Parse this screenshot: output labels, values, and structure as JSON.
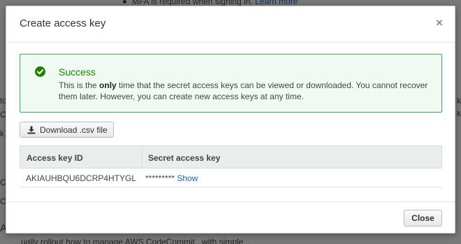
{
  "background": {
    "top_text": "MFA is required when signing in.",
    "top_link": "Learn more",
    "left_fragments": [
      "to",
      "C",
      "k",
      "C",
      "C"
    ],
    "right_fragments": [
      "k",
      "k"
    ],
    "heading_fragment": "A",
    "bottom_text": "...ually rollout how to manage AWS CodeCommit...with simple..."
  },
  "modal": {
    "title": "Create access key",
    "close_icon": "×",
    "alert": {
      "icon": "check-circle-icon",
      "title": "Success",
      "body_pre": "This is the ",
      "body_bold": "only",
      "body_post": " time that the secret access keys can be viewed or downloaded. You cannot recover them later. However, you can create new access keys at any time."
    },
    "download_button": "Download .csv file",
    "table": {
      "headers": [
        "Access key ID",
        "Secret access key"
      ],
      "rows": [
        {
          "access_key_id": "AKIAUHBQU6DCRP4HTYGL",
          "secret_masked": "*********",
          "show_label": "Show"
        }
      ]
    },
    "footer": {
      "close_button": "Close"
    }
  },
  "colors": {
    "success_green": "#1d8102",
    "alert_border": "#3faa5a",
    "link_blue": "#1a62b3"
  }
}
